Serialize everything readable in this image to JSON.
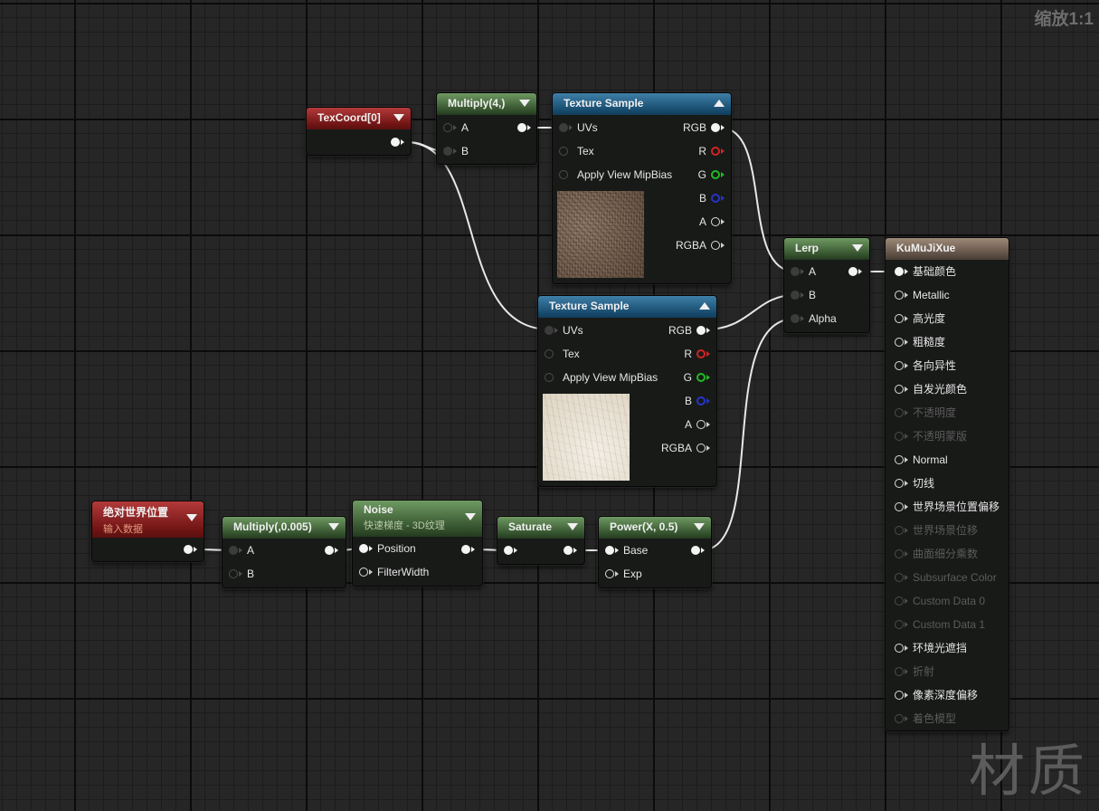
{
  "zoom_label": "缩放1:1",
  "watermark": "材质",
  "nodes": {
    "texcoord": {
      "title": "TexCoord[0]"
    },
    "multiply4": {
      "title": "Multiply(4,)",
      "pin_a": "A",
      "pin_b": "B"
    },
    "texsample1": {
      "title": "Texture Sample",
      "in_uvs": "UVs",
      "in_tex": "Tex",
      "in_mip": "Apply View MipBias",
      "out_rgb": "RGB",
      "out_r": "R",
      "out_g": "G",
      "out_b": "B",
      "out_a": "A",
      "out_rgba": "RGBA"
    },
    "texsample2": {
      "title": "Texture Sample",
      "in_uvs": "UVs",
      "in_tex": "Tex",
      "in_mip": "Apply View MipBias",
      "out_rgb": "RGB",
      "out_r": "R",
      "out_g": "G",
      "out_b": "B",
      "out_a": "A",
      "out_rgba": "RGBA"
    },
    "lerp": {
      "title": "Lerp",
      "pin_a": "A",
      "pin_b": "B",
      "pin_alpha": "Alpha"
    },
    "material": {
      "title": "KuMuJiXue",
      "pins": [
        {
          "label": "基础颜色",
          "enabled": true,
          "connected": true
        },
        {
          "label": "Metallic",
          "enabled": true,
          "connected": false
        },
        {
          "label": "高光度",
          "enabled": true,
          "connected": false
        },
        {
          "label": "粗糙度",
          "enabled": true,
          "connected": false
        },
        {
          "label": "各向异性",
          "enabled": true,
          "connected": false
        },
        {
          "label": "自发光颜色",
          "enabled": true,
          "connected": false
        },
        {
          "label": "不透明度",
          "enabled": false,
          "connected": false
        },
        {
          "label": "不透明蒙版",
          "enabled": false,
          "connected": false
        },
        {
          "label": "Normal",
          "enabled": true,
          "connected": false
        },
        {
          "label": "切线",
          "enabled": true,
          "connected": false
        },
        {
          "label": "世界场景位置偏移",
          "enabled": true,
          "connected": false
        },
        {
          "label": "世界场景位移",
          "enabled": false,
          "connected": false
        },
        {
          "label": "曲面细分乘数",
          "enabled": false,
          "connected": false
        },
        {
          "label": "Subsurface Color",
          "enabled": false,
          "connected": false
        },
        {
          "label": "Custom Data 0",
          "enabled": false,
          "connected": false
        },
        {
          "label": "Custom Data 1",
          "enabled": false,
          "connected": false
        },
        {
          "label": "环境光遮挡",
          "enabled": true,
          "connected": false
        },
        {
          "label": "折射",
          "enabled": false,
          "connected": false
        },
        {
          "label": "像素深度偏移",
          "enabled": true,
          "connected": false
        },
        {
          "label": "着色模型",
          "enabled": false,
          "connected": false
        }
      ]
    },
    "worldpos": {
      "title": "绝对世界位置",
      "subtitle": "输入数据"
    },
    "multiply005": {
      "title": "Multiply(,0.005)",
      "pin_a": "A",
      "pin_b": "B"
    },
    "noise": {
      "title": "Noise",
      "subtitle": "快速梯度 - 3D纹理",
      "pin_position": "Position",
      "pin_filterwidth": "FilterWidth"
    },
    "saturate": {
      "title": "Saturate"
    },
    "power": {
      "title": "Power(X, 0.5)",
      "pin_base": "Base",
      "pin_exp": "Exp"
    }
  }
}
